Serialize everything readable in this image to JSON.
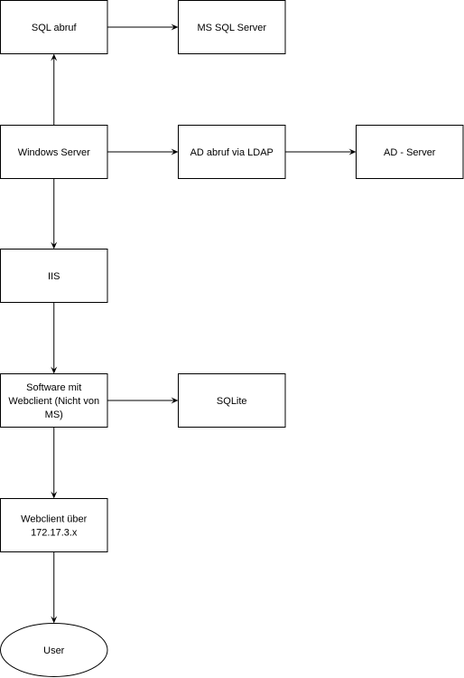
{
  "diagram": {
    "nodes": [
      {
        "id": "sql-abruf",
        "shape": "rect",
        "lines": [
          "SQL abruf"
        ]
      },
      {
        "id": "ms-sql-server",
        "shape": "rect",
        "lines": [
          "MS SQL Server"
        ]
      },
      {
        "id": "windows-server",
        "shape": "rect",
        "lines": [
          "Windows Server"
        ]
      },
      {
        "id": "ad-abruf",
        "shape": "rect",
        "lines": [
          "AD abruf via LDAP"
        ]
      },
      {
        "id": "ad-server",
        "shape": "rect",
        "lines": [
          "AD - Server"
        ]
      },
      {
        "id": "iis",
        "shape": "rect",
        "lines": [
          "IIS"
        ]
      },
      {
        "id": "software",
        "shape": "rect",
        "lines": [
          "Software mit",
          "Webclient (Nicht von",
          "MS)"
        ]
      },
      {
        "id": "sqlite",
        "shape": "rect",
        "lines": [
          "SQLite"
        ]
      },
      {
        "id": "webclient",
        "shape": "rect",
        "lines": [
          "Webclient über",
          "172.17.3.x"
        ]
      },
      {
        "id": "user",
        "shape": "ellipse",
        "lines": [
          "User"
        ]
      }
    ],
    "edges": [
      {
        "from": "sql-abruf",
        "to": "ms-sql-server"
      },
      {
        "from": "windows-server",
        "to": "sql-abruf"
      },
      {
        "from": "windows-server",
        "to": "ad-abruf"
      },
      {
        "from": "ad-abruf",
        "to": "ad-server"
      },
      {
        "from": "windows-server",
        "to": "iis"
      },
      {
        "from": "iis",
        "to": "software"
      },
      {
        "from": "software",
        "to": "sqlite"
      },
      {
        "from": "software",
        "to": "webclient"
      },
      {
        "from": "webclient",
        "to": "user"
      }
    ],
    "colors": {
      "stroke": "#000000",
      "fill": "#ffffff",
      "text": "#000000"
    }
  }
}
